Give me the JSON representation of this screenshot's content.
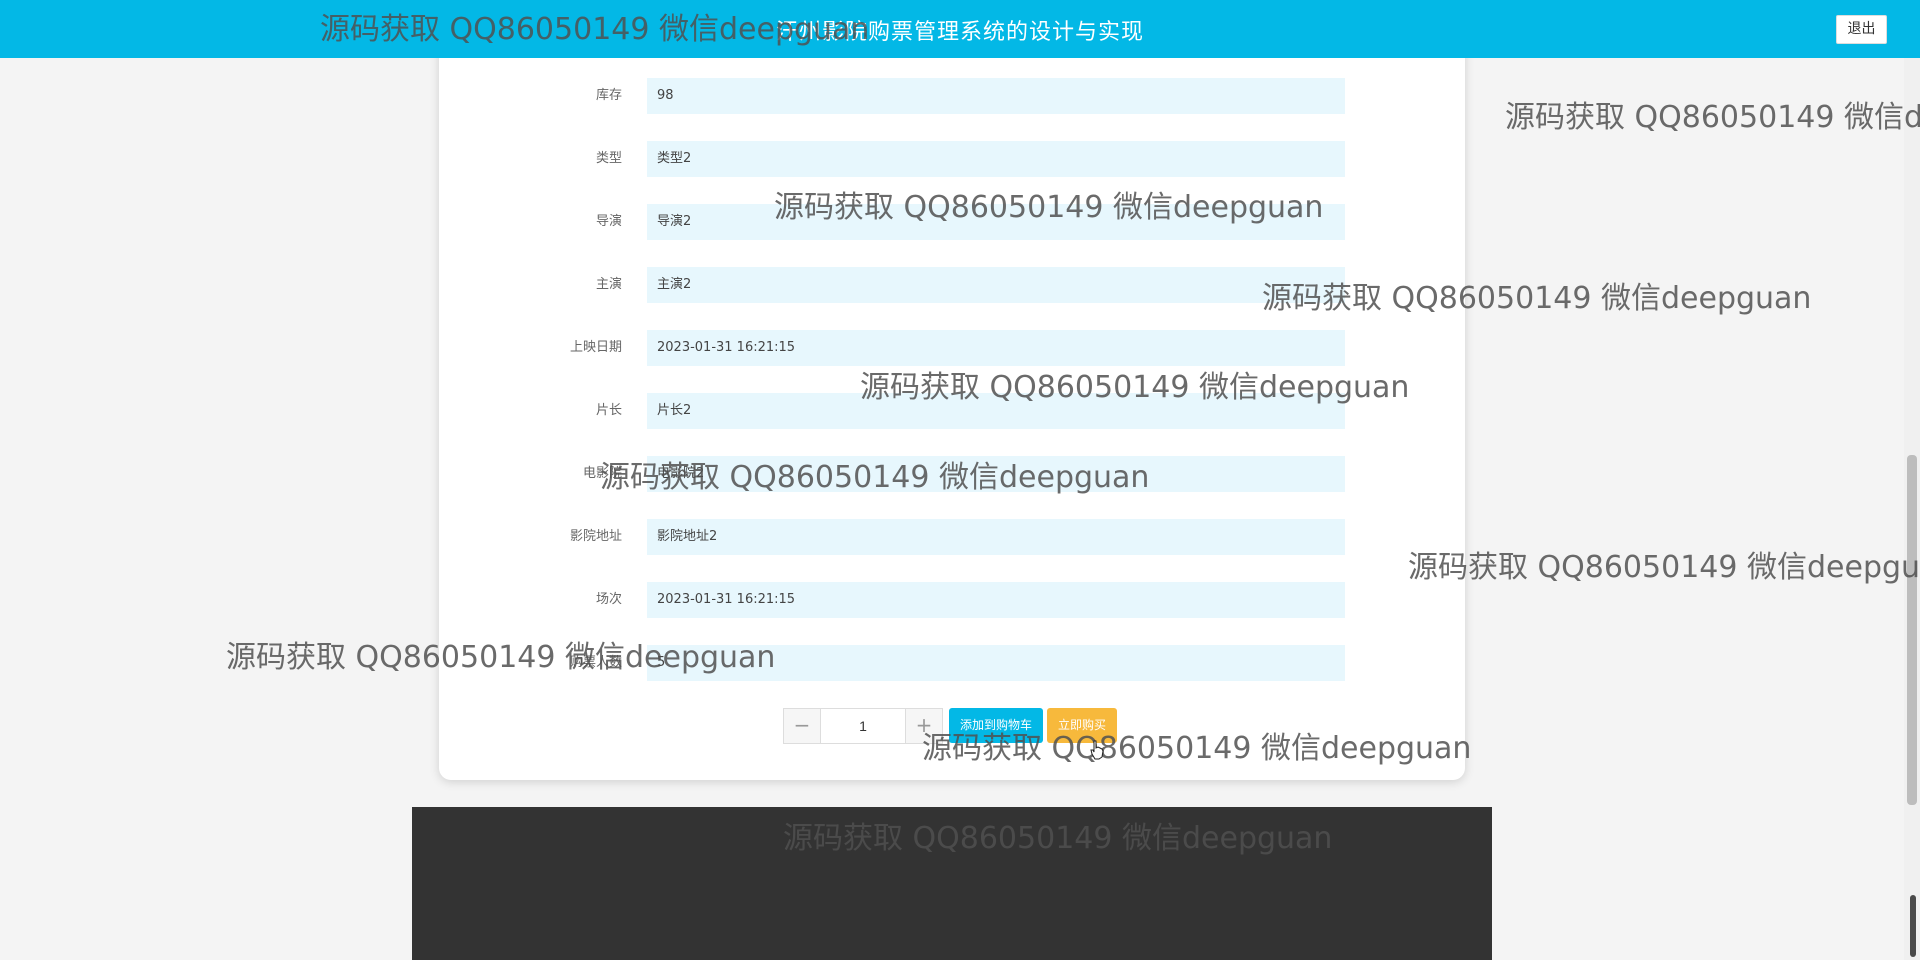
{
  "header": {
    "title": "汗州影院购票管理系统的设计与实现",
    "logout_label": "退出",
    "background": "#03b8e6"
  },
  "details": [
    {
      "label": "库存",
      "value": "98"
    },
    {
      "label": "类型",
      "value": "类型2"
    },
    {
      "label": "导演",
      "value": "导演2"
    },
    {
      "label": "主演",
      "value": "主演2"
    },
    {
      "label": "上映日期",
      "value": "2023-01-31 16:21:15"
    },
    {
      "label": "片长",
      "value": "片长2"
    },
    {
      "label": "电影院",
      "value": "电影院2"
    },
    {
      "label": "影院地址",
      "value": "影院地址2"
    },
    {
      "label": "场次",
      "value": "2023-01-31 16:21:15"
    },
    {
      "label": "购票人数",
      "value": "5"
    }
  ],
  "purchase": {
    "minus_label": "−",
    "quantity": "1",
    "plus_label": "+",
    "add_to_cart_label": "添加到购物车",
    "buy_now_label": "立即购买",
    "cart_color": "#03b8e6",
    "buy_color": "#f7b93c"
  },
  "watermark": {
    "text": "源码获取 QQ86050149 微信deepguan"
  }
}
